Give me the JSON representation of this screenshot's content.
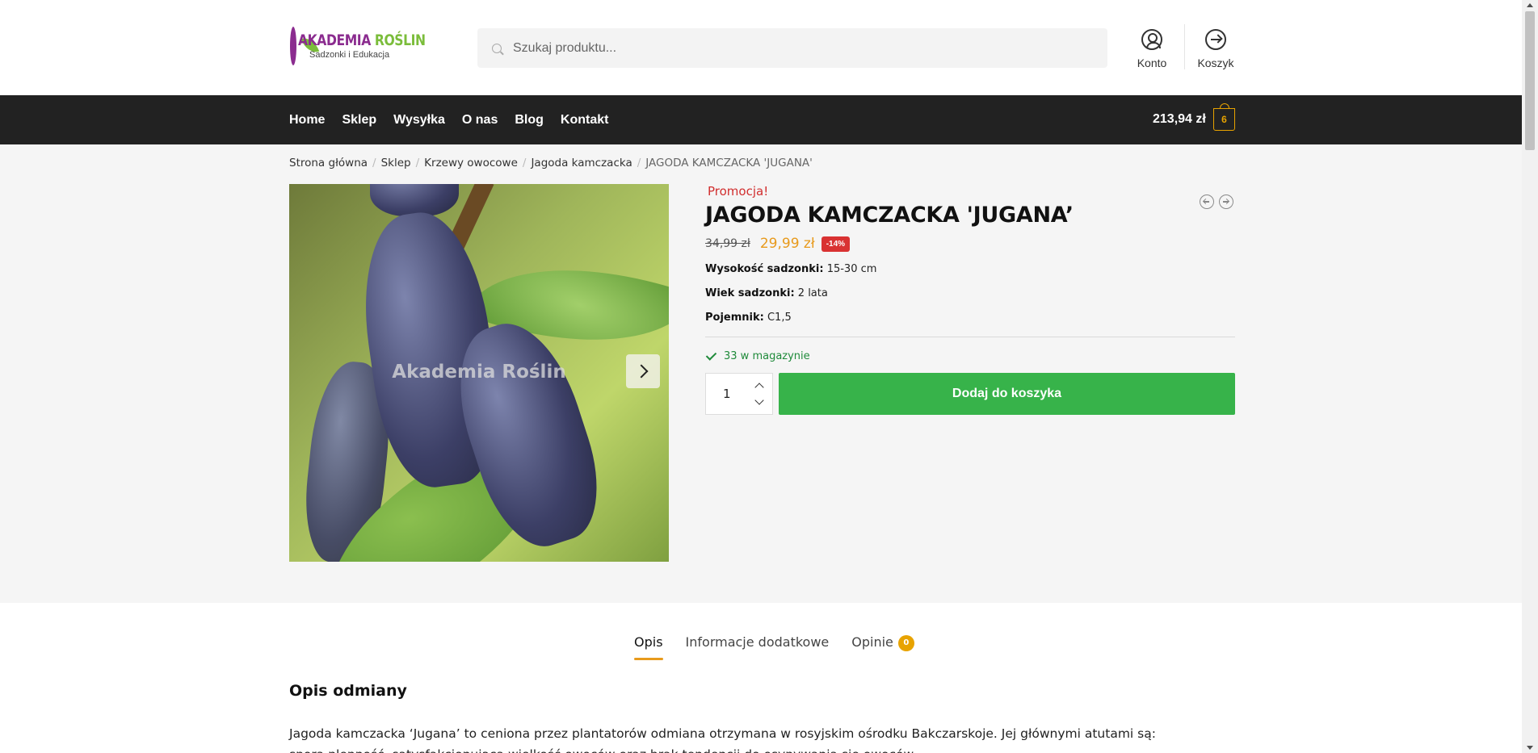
{
  "header": {
    "logo_title_part1": "AKADEMIA ",
    "logo_title_part2": "ROŚLIN",
    "logo_subtitle": "Sadzonki i Edukacja",
    "search_placeholder": "Szukaj produktu...",
    "account_label": "Konto",
    "cart_label": "Koszyk"
  },
  "nav": {
    "items": [
      "Home",
      "Sklep",
      "Wysyłka",
      "O nas",
      "Blog",
      "Kontakt"
    ],
    "cart_total": "213,94 zł",
    "cart_count": "6"
  },
  "breadcrumb": {
    "items": [
      "Strona główna",
      "Sklep",
      "Krzewy owocowe",
      "Jagoda kamczacka"
    ],
    "current": "JAGODA KAMCZACKA 'JUGANA'"
  },
  "gallery": {
    "watermark": "Akademia Roślin"
  },
  "product": {
    "sale_label": "Promocja!",
    "title": "JAGODA KAMCZACKA 'JUGANA’",
    "old_price": "34,99 zł",
    "new_price": "29,99 zł",
    "discount": "-14%",
    "attributes": [
      {
        "label": "Wysokość sadzonki:",
        "value": " 15-30 cm"
      },
      {
        "label": "Wiek sadzonki:",
        "value": " 2 lata"
      },
      {
        "label": "Pojemnik:",
        "value": " C1,5"
      }
    ],
    "stock": "33 w magazynie",
    "quantity": "1",
    "add_to_cart": "Dodaj do koszyka"
  },
  "tabs": {
    "items": [
      "Opis",
      "Informacje dodatkowe",
      "Opinie"
    ],
    "reviews_count": "0"
  },
  "description": {
    "heading": "Opis odmiany",
    "text": "Jagoda kamczacka ‘Jugana’ to ceniona przez plantatorów odmiana otrzymana w rosyjskim ośrodku Bakczarskoje. Jej głównymi atutami są: spora plenność, satysfakcjonująca wielkość owoców oraz brak tendencji do osypywania się owoców."
  },
  "colors": {
    "accent": "#e89a1c",
    "add_button": "#37b34a",
    "nav_bg": "#222222",
    "sale_red": "#d12e2e",
    "stock_green": "#1f8a3a"
  }
}
